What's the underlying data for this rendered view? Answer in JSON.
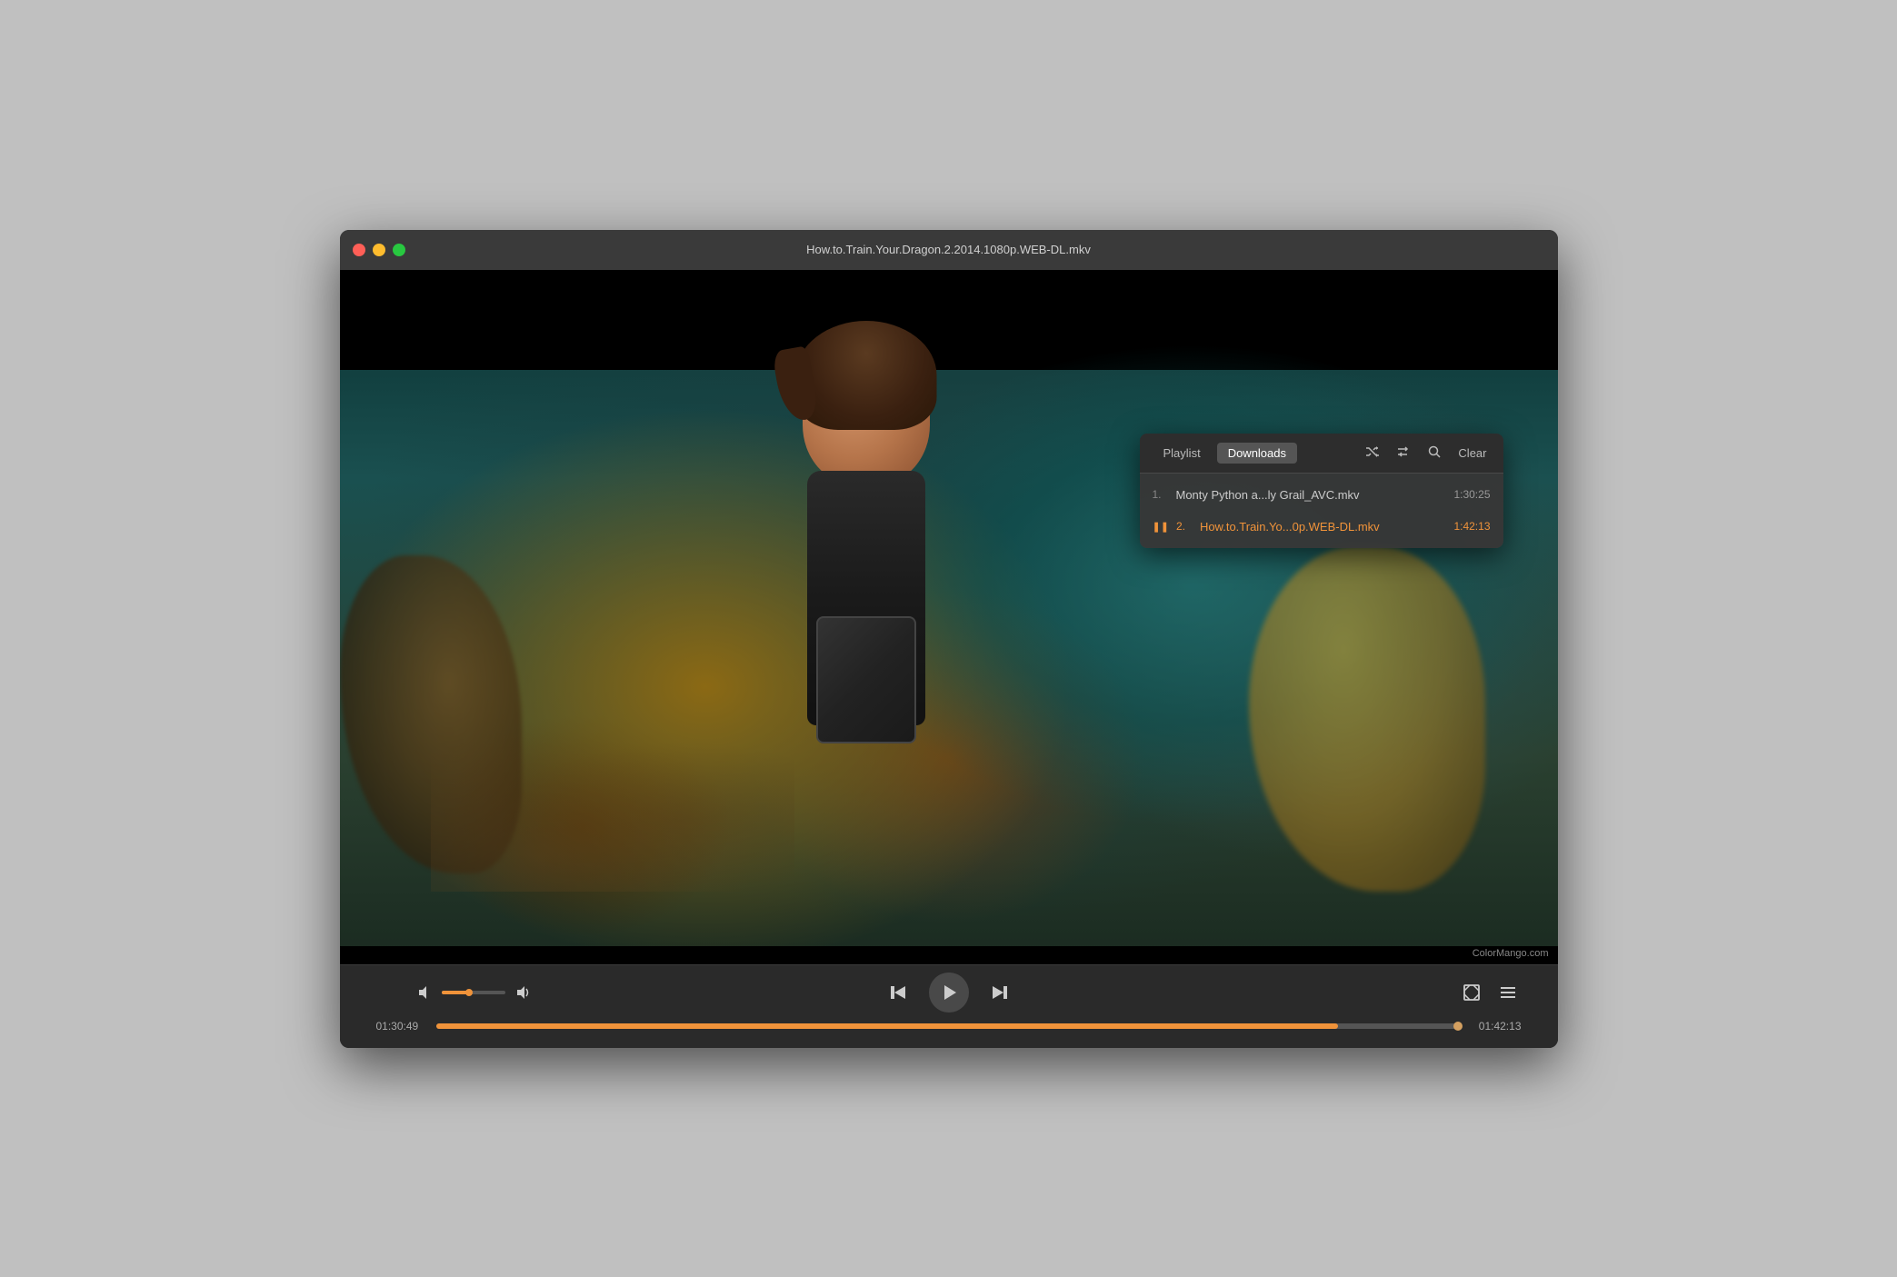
{
  "window": {
    "title": "How.to.Train.Your.Dragon.2.2014.1080p.WEB-DL.mkv"
  },
  "traffic_lights": {
    "close_label": "close",
    "minimize_label": "minimize",
    "maximize_label": "maximize"
  },
  "playlist": {
    "tab_playlist": "Playlist",
    "tab_downloads": "Downloads",
    "clear_label": "Clear",
    "items": [
      {
        "index": "1.",
        "name": "Monty Python a...ly Grail_AVC.mkv",
        "duration": "1:30:25",
        "active": false,
        "playing": false
      },
      {
        "index": "2.",
        "name": "How.to.Train.Yo...0p.WEB-DL.mkv",
        "duration": "1:42:13",
        "active": true,
        "playing": true
      }
    ]
  },
  "controls": {
    "time_current": "01:30:49",
    "time_total": "01:42:13",
    "progress_percent": 88,
    "volume_percent": 40,
    "play_icon": "▶",
    "prev_icon": "⏮",
    "next_icon": "⏭",
    "fullscreen_icon": "⛶",
    "playlist_icon": "☰",
    "volume_low_icon": "🔈",
    "volume_high_icon": "🔊"
  },
  "watermark": {
    "text": "ColorMango.com"
  }
}
